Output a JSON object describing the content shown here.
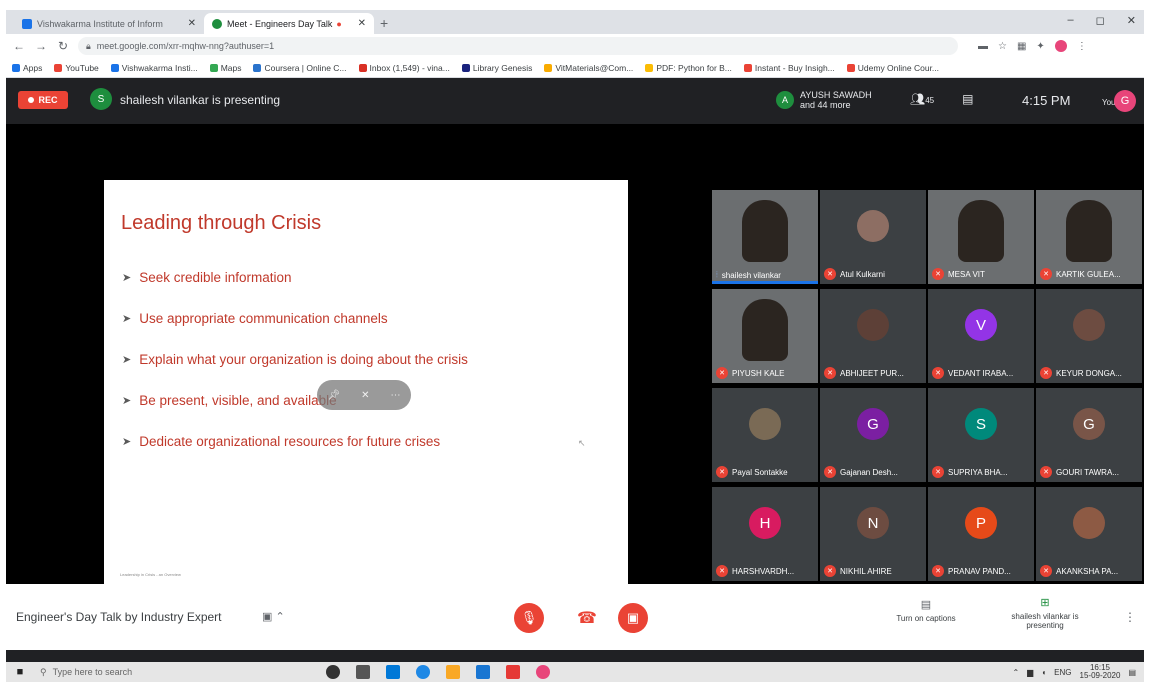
{
  "browser": {
    "tabs": [
      {
        "label": "Vishwakarma Institute of Inform",
        "active": false
      },
      {
        "label": "Meet - Engineers Day Talk",
        "active": true
      }
    ],
    "new_tab": "+",
    "window_controls": [
      "–",
      "◻",
      "✕"
    ],
    "url": "meet.google.com/xrr-mqhw-nng?authuser=1",
    "bookmarks": [
      "Apps",
      "YouTube",
      "Vishwakarma Insti...",
      "Maps",
      "Coursera | Online C...",
      "Inbox (1,549) - vina...",
      "Library Genesis",
      "VitMaterials@Com...",
      "PDF: Python for B...",
      "Instant - Buy Insigh...",
      "Udemy Online Cour..."
    ]
  },
  "meet": {
    "rec_label": "REC",
    "presenter_initial": "S",
    "presenting_text": "shailesh vilankar is presenting",
    "others_initial": "A",
    "others_text": "AYUSH SAWADH and 44 more",
    "participants_count": "45",
    "clock": "4:15 PM",
    "you_label": "You",
    "you_initial": "G"
  },
  "slide": {
    "title": "Leading through Crisis",
    "bullets": [
      "Seek credible information",
      "Use appropriate communication channels",
      "Explain what your organization is doing about the crisis",
      "Be present, visible, and available",
      "Dedicate organizational resources for future crises"
    ],
    "footer": "Leadership in Crisis - an Overview"
  },
  "participants": [
    {
      "name": "shailesh vilankar",
      "type": "video",
      "muted": false,
      "speaking": true
    },
    {
      "name": "Atul Kulkarni",
      "type": "photo",
      "initial": "",
      "color": "#8d6e63",
      "muted": true
    },
    {
      "name": "MESA VIT",
      "type": "video",
      "muted": true
    },
    {
      "name": "KARTIK GULEA...",
      "type": "video",
      "muted": true
    },
    {
      "name": "PIYUSH KALE",
      "type": "video",
      "muted": true
    },
    {
      "name": "ABHIJEET PUR...",
      "type": "photo",
      "initial": "",
      "color": "#5d4037",
      "muted": true
    },
    {
      "name": "VEDANT IRABA...",
      "type": "initial",
      "initial": "V",
      "color": "#9334e6",
      "muted": true
    },
    {
      "name": "KEYUR DONGA...",
      "type": "photo",
      "initial": "",
      "color": "#6d4c41",
      "muted": true
    },
    {
      "name": "Payal Sontakke",
      "type": "photo",
      "initial": "",
      "color": "#7a6a55",
      "muted": true
    },
    {
      "name": "Gajanan Desh...",
      "type": "initial",
      "initial": "G",
      "color": "#7b1fa2",
      "muted": true
    },
    {
      "name": "SUPRIYA BHA...",
      "type": "initial",
      "initial": "S",
      "color": "#00897b",
      "muted": true
    },
    {
      "name": "GOURI TAWRA...",
      "type": "initial",
      "initial": "G",
      "color": "#795548",
      "muted": true
    },
    {
      "name": "HARSHVARDH...",
      "type": "initial",
      "initial": "H",
      "color": "#d81b60",
      "muted": true
    },
    {
      "name": "NIKHIL AHIRE",
      "type": "initial",
      "initial": "N",
      "color": "#6d4c41",
      "muted": true
    },
    {
      "name": "PRANAV PAND...",
      "type": "initial",
      "initial": "P",
      "color": "#e64a19",
      "muted": true
    },
    {
      "name": "AKANKSHA PA...",
      "type": "photo",
      "initial": "",
      "color": "#8d5a44",
      "muted": true
    }
  ],
  "bottom_bar": {
    "meeting_title": "Engineer's Day Talk by Industry Expert",
    "captions_label": "Turn on captions",
    "presenting_status": "shailesh vilankar is presenting"
  },
  "taskbar": {
    "search_placeholder": "Type here to search",
    "tray": [
      "ENG",
      "16:15",
      "15-09-2020"
    ]
  },
  "colors": {
    "rec": "#ea4335",
    "slide_text": "#c0392b",
    "meet_dark": "#202124",
    "tile": "#3c4043",
    "speaking": "#1a73e8"
  }
}
